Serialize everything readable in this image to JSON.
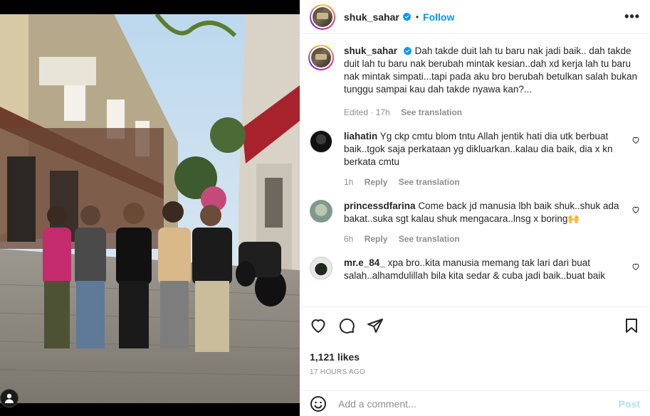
{
  "post": {
    "username": "shuk_sahar",
    "follow_label": "Follow",
    "separator": "•",
    "more_label": "•••"
  },
  "caption": {
    "username": "shuk_sahar",
    "text": "Dah takde duit lah tu baru nak jadi baik.. dah takde duit lah tu baru nak berubah mintak kesian..dah xd kerja lah tu baru nak mintak simpati...tapi pada aku bro berubah betulkan salah bukan tunggu sampai kau dah takde nyawa kan?...",
    "edited": "Edited",
    "time": "17h",
    "translate": "See translation"
  },
  "comments": [
    {
      "username": "liahatin",
      "text": "Yg ckp cmtu blom tntu Allah jentik hati dia utk berbuat baik..tgok saja perkataan yg dikluarkan..kalau dia baik, dia x kn berkata cmtu",
      "time": "1h",
      "reply": "Reply",
      "translate": "See translation"
    },
    {
      "username": "princessdfarina",
      "text": "Come back jd manusia lbh baik shuk..shuk ada bakat..suka sgt kalau shuk mengacara..lnsg x boring🙌",
      "time": "6h",
      "reply": "Reply",
      "translate": "See translation"
    },
    {
      "username": "mr.e_84_",
      "text": "xpa bro..kita manusia memang tak lari dari buat salah..alhamdulillah bila kita sedar & cuba jadi baik..buat baik",
      "time": "",
      "reply": "",
      "translate": ""
    }
  ],
  "likes": "1,121 likes",
  "timestamp": "17 HOURS AGO",
  "comment_box": {
    "placeholder": "Add a comment...",
    "post_label": "Post"
  },
  "colors": {
    "accent": "#0095f6",
    "post_disabled": "#b2dffc",
    "muted": "#8e8e8e",
    "text": "#262626"
  },
  "icons": [
    "heart-icon",
    "comment-icon",
    "share-icon",
    "bookmark-icon",
    "emoji-icon",
    "verified-badge-icon",
    "user-tag-icon"
  ]
}
